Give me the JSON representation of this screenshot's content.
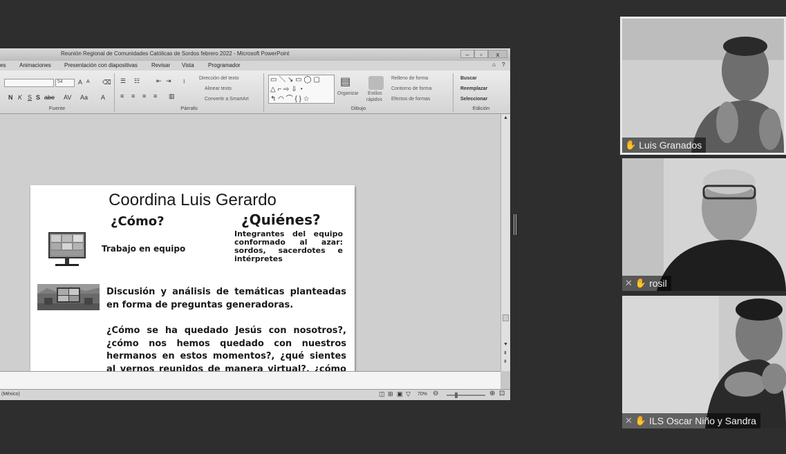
{
  "window": {
    "title": "Reunión Regional de Comunidades Católicas de Sordos febrero 2022  -  Microsoft PowerPoint",
    "tabs": [
      "es",
      "Animaciones",
      "Presentación con diapositivas",
      "Revisar",
      "Vista",
      "Programador"
    ]
  },
  "ribbon": {
    "font": {
      "size_value": "54",
      "group_label": "Fuente",
      "bold": "N",
      "italic": "K",
      "underline": "S",
      "strike": "S",
      "shadow": "abe",
      "spacing": "AV",
      "case": "Aa",
      "grow": "A",
      "shrink": "A",
      "color": "A"
    },
    "paragraph": {
      "group_label": "Párrafo",
      "text_direction": "Dirección del texto",
      "align_text": "Alinear texto",
      "smartart": "Convertir a SmartArt"
    },
    "drawing": {
      "group_label": "Dibujo",
      "arrange": "Organizar",
      "quick_styles_1": "Estilos",
      "quick_styles_2": "rápidos",
      "fill": "Relleno de forma",
      "outline": "Contorno de forma",
      "effects": "Efectos de formas"
    },
    "editing": {
      "group_label": "Edición",
      "find": "Buscar",
      "replace": "Reemplazar",
      "select": "Seleccionar"
    }
  },
  "status": {
    "language": "(México)",
    "zoom": "70%"
  },
  "slide": {
    "title": "Coordina Luis Gerardo",
    "como_heading": "¿Cómo?",
    "quienes_heading": "¿Quiénes?",
    "quienes_text": "Integrantes del equipo conformado al azar: sordos, sacerdotes e intérpretes",
    "trabajo": "Trabajo en equipo",
    "discusion": "Discusión y análisis de temáticas planteadas en forma de preguntas generadoras.",
    "preguntas": "¿Cómo se ha quedado Jesús con nosotros?, ¿cómo nos hemos quedado con nuestros hermanos en estos momentos?, ¿qué sientes al vernos reunidos de manera virtual?, ¿cómo podemos promover que el corazón nos arda igual que a los discípulos?"
  },
  "participants": [
    {
      "name": "Luis Granados",
      "muted": false
    },
    {
      "name": "rosil",
      "muted": true
    },
    {
      "name": "ILS Oscar Niño y Sandra",
      "muted": true
    }
  ]
}
